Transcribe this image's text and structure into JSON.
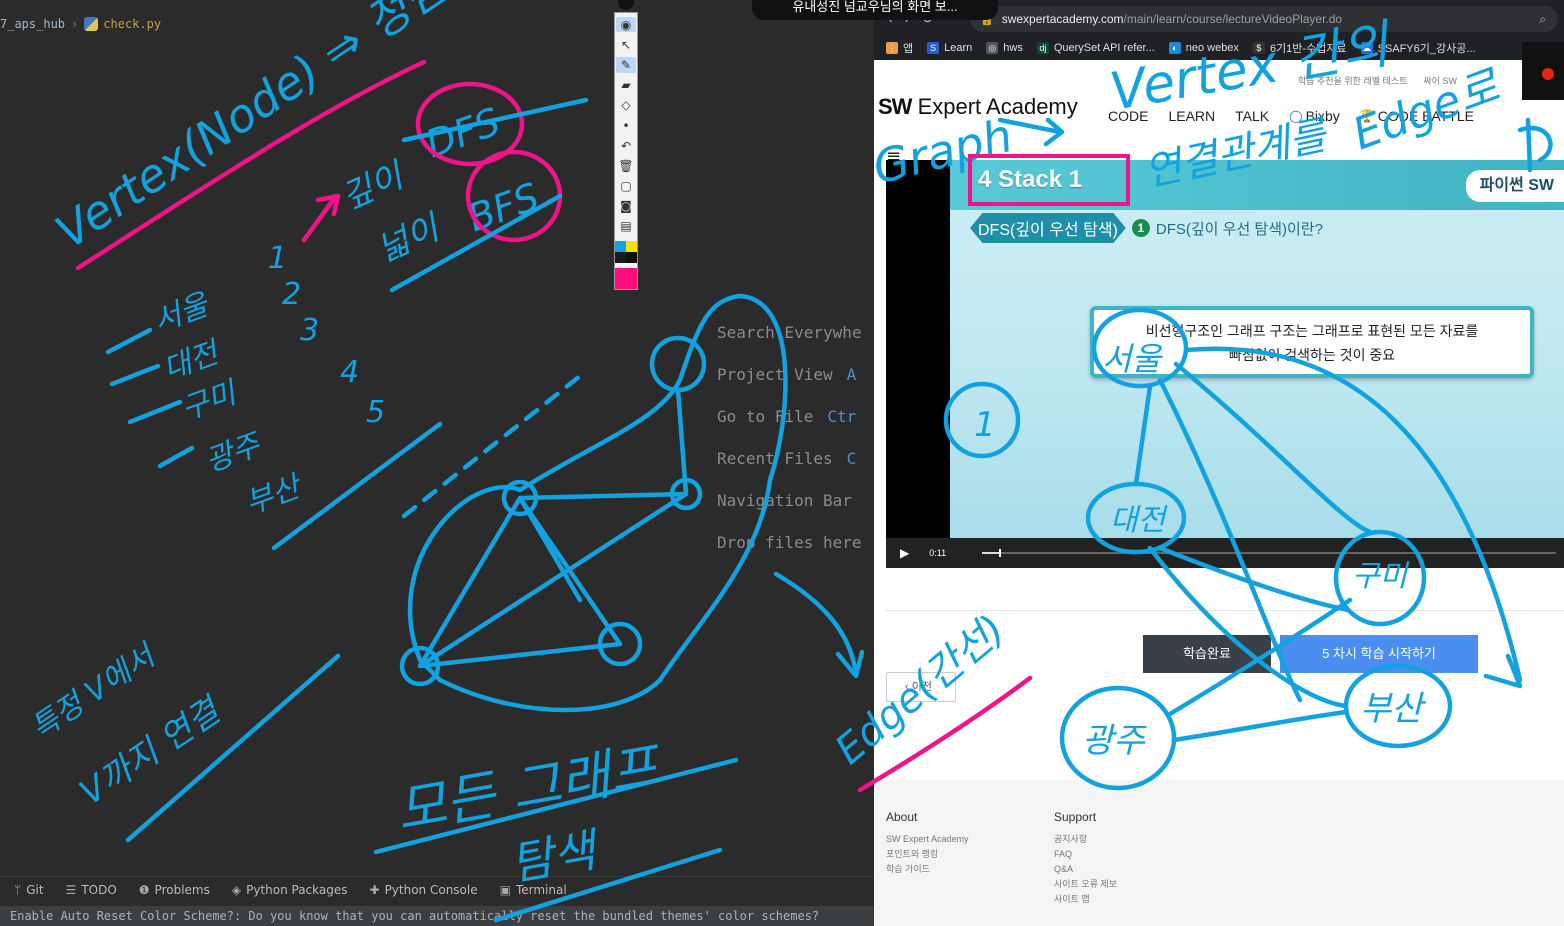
{
  "tooltip": "유내성진 넘교우님의 화면 보...",
  "ide": {
    "breadcrumb_project": "7_aps_hub",
    "breadcrumb_file": "check.py",
    "hints": [
      {
        "label": "Search Everywhe",
        "key": ""
      },
      {
        "label": "Project View",
        "key": "A"
      },
      {
        "label": "Go to File",
        "key": "Ctr"
      },
      {
        "label": "Recent Files",
        "key": "C"
      },
      {
        "label": "Navigation Bar",
        "key": ""
      },
      {
        "label": "Drop files here",
        "key": ""
      }
    ],
    "tool_windows": [
      {
        "icon": "git-icon",
        "glyph": "ᛘ",
        "label": "Git"
      },
      {
        "icon": "todo-icon",
        "glyph": "☰",
        "label": "TODO"
      },
      {
        "icon": "problems-icon",
        "glyph": "❶",
        "label": "Problems"
      },
      {
        "icon": "python-packages-icon",
        "glyph": "◈",
        "label": "Python Packages"
      },
      {
        "icon": "python-console-icon",
        "glyph": "✚",
        "label": "Python Console"
      },
      {
        "icon": "terminal-icon",
        "glyph": "▣",
        "label": "Terminal"
      }
    ],
    "status_message": "Enable Auto Reset Color Scheme?: Do you know that you can automatically reset the bundled themes' color schemes?"
  },
  "annotation_toolbar": {
    "tools": [
      "eye-icon",
      "cursor-icon",
      "pen-icon",
      "highlighter-icon",
      "eraser-icon",
      "dot-icon",
      "undo-icon",
      "trash-icon",
      "screen-icon",
      "camera-icon",
      "clipboard-icon"
    ],
    "colors": [
      "#13a2e0",
      "#f5e400",
      "#1a1a1a",
      "#111111"
    ],
    "active_color": "#ff0c7d"
  },
  "browser": {
    "url_host": "swexpertacademy.com",
    "url_path": "/main/learn/course/lectureVideoPlayer.do",
    "bookmarks": [
      "앱",
      "Learn",
      "hws",
      "QuerySet API refer...",
      "neo webex",
      "6기1반-수업자료",
      "SSAFY6기_강사공..."
    ],
    "top_links": [
      "학습 추천을 위한 레벨 테스트",
      "싸이 SW"
    ],
    "logo_bold": "SW",
    "logo_rest": " Expert Academy",
    "nav": [
      "CODE",
      "LEARN",
      "TALK",
      "Bixby",
      "CODE BATTLE"
    ],
    "lecture_title": "4 Stack 1",
    "course_tag": "파이썬 SW",
    "section": "DFS(깊이 우선 탐색)",
    "section_num": "1",
    "section_sub": "DFS(깊이 우선 탐색)이란?",
    "caption_line1": "비선형구조인 그래프 구조는 그래프로 표현된 모든 자료를",
    "caption_line2": "빠짐없이 검색하는 것이 중요",
    "video_time": "0:11",
    "video_progress": 0.03,
    "btn_done": "학습완료",
    "btn_next": "5 차시 학습 시작하기",
    "btn_prev": "이전",
    "footer": {
      "about_title": "About",
      "about_links": [
        "SW Expert Academy",
        "포인트와 랭킹",
        "학습 가이드"
      ],
      "support_title": "Support",
      "support_links": [
        "공지사항",
        "FAQ",
        "Q&A",
        "사이트 오류 제보",
        "사이트 맵"
      ]
    }
  },
  "handwriting": {
    "vertex_node": "Vertex(Node) ⇒ 정점",
    "bfs_dfs": [
      "DFS",
      "BFS"
    ],
    "depth_width": [
      "깊이",
      "넓이"
    ],
    "cities": [
      "서울",
      "대전",
      "구미",
      "광주",
      "부산"
    ],
    "numbers": [
      "1",
      "2",
      "3",
      "4",
      "5"
    ],
    "specific_v": "특정 V에서",
    "v_connect": "V까지 연결",
    "all_graph": "모든 그래프",
    "search": "탐색",
    "edge_kr": "Edge(간선)",
    "graph": "Graph",
    "vertex": "Vertex 간의",
    "relation": "연결관계를",
    "edge2": "Edge로",
    "node_labels": [
      "서울",
      "대전",
      "구미",
      "광주",
      "부산"
    ]
  }
}
